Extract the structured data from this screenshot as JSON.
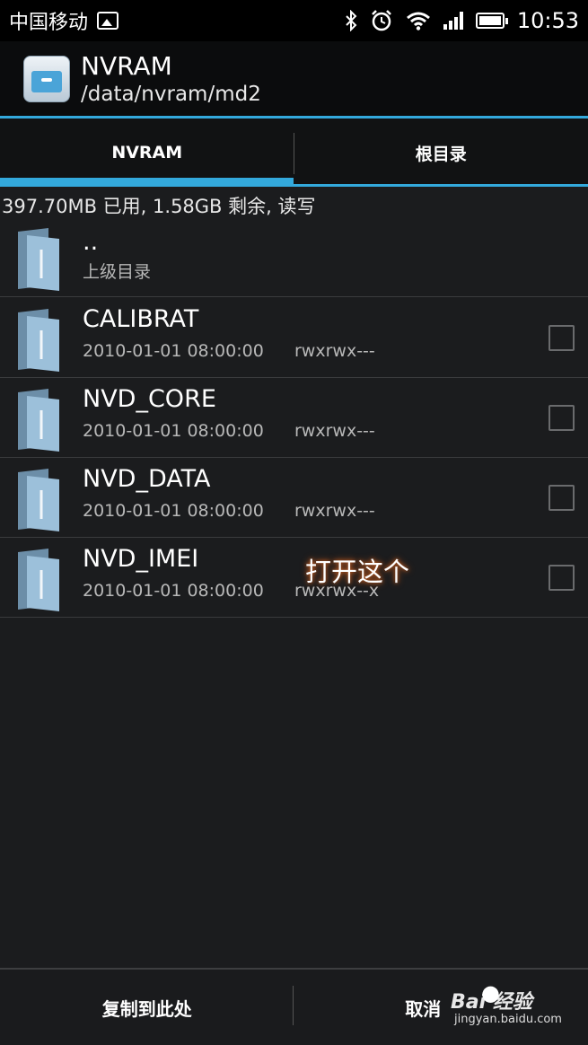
{
  "status_bar": {
    "carrier": "中国移动",
    "time": "10:53",
    "icons": [
      "image-icon",
      "bluetooth-icon",
      "alarm-icon",
      "wifi-icon",
      "signal-icon",
      "battery-icon"
    ]
  },
  "app_bar": {
    "title": "NVRAM",
    "path": "/data/nvram/md2",
    "accent_color": "#33a9dc"
  },
  "tabs": [
    {
      "label": "NVRAM",
      "active": true
    },
    {
      "label": "根目录",
      "active": false
    }
  ],
  "storage_info": "397.70MB 已用, 1.58GB 剩余, 读写",
  "parent_entry": {
    "name": "..",
    "subtitle": "上级目录"
  },
  "files": [
    {
      "name": "CALIBRAT",
      "date": "2010-01-01 08:00:00",
      "permissions": "rwxrwx---",
      "checked": false
    },
    {
      "name": "NVD_CORE",
      "date": "2010-01-01 08:00:00",
      "permissions": "rwxrwx---",
      "checked": false
    },
    {
      "name": "NVD_DATA",
      "date": "2010-01-01 08:00:00",
      "permissions": "rwxrwx---",
      "checked": false
    },
    {
      "name": "NVD_IMEI",
      "date": "2010-01-01 08:00:00",
      "permissions": "rwxrwx--x",
      "checked": false
    }
  ],
  "annotation": "打开这个",
  "bottom_bar": {
    "copy_here": "复制到此处",
    "cancel": "取消"
  },
  "watermark": {
    "main": "Bai  经验",
    "sub": "jingyan.baidu.com"
  }
}
